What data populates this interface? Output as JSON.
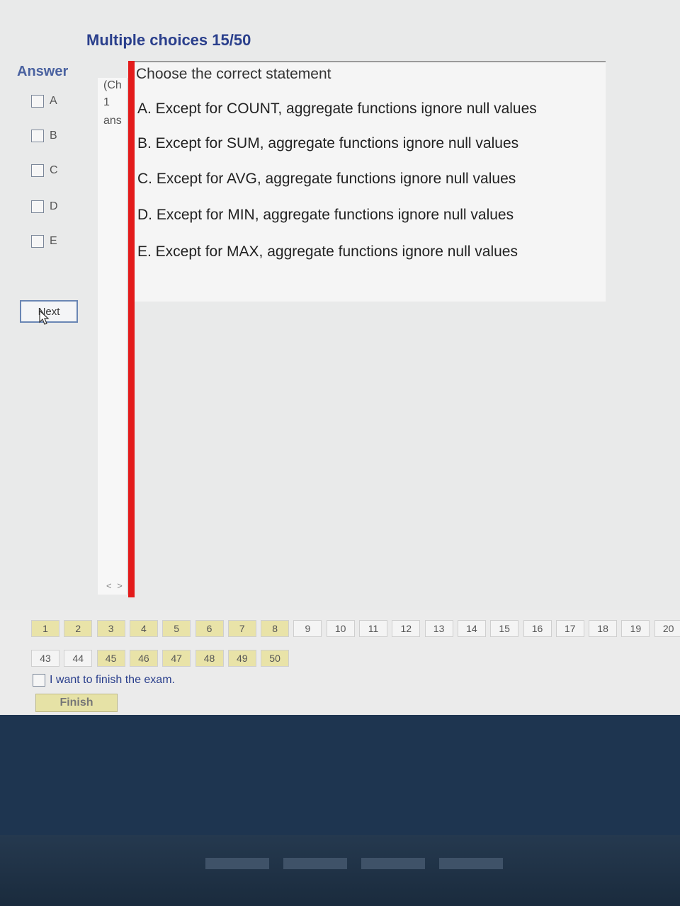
{
  "header": {
    "title": "Multiple choices 15/50"
  },
  "answer_panel": {
    "label": "Answer",
    "options": [
      "A",
      "B",
      "C",
      "D",
      "E"
    ],
    "next_button": "Next"
  },
  "middle_panel": {
    "lines": [
      "(Ch",
      "1",
      "ans"
    ],
    "scroll": "< >"
  },
  "question": {
    "prompt": "Choose the correct statement",
    "choices": [
      "A. Except for COUNT, aggregate functions ignore null values",
      "B. Except for SUM, aggregate functions ignore null values",
      "C. Except for AVG, aggregate functions ignore null values",
      "D. Except for MIN, aggregate functions ignore null values",
      "E. Except for MAX, aggregate functions ignore null values"
    ]
  },
  "pager": {
    "row1": [
      "1",
      "2",
      "3",
      "4",
      "5",
      "6",
      "7",
      "8",
      "9",
      "10",
      "11",
      "12",
      "13",
      "14",
      "15",
      "16",
      "17",
      "18",
      "19",
      "20"
    ],
    "row2": [
      "43",
      "44",
      "45",
      "46",
      "47",
      "48",
      "49",
      "50"
    ],
    "answered_row1": [
      "1",
      "2",
      "3",
      "4",
      "5",
      "6",
      "7",
      "8"
    ],
    "answered_row2": [
      "45",
      "46",
      "47",
      "48",
      "49",
      "50"
    ]
  },
  "finish": {
    "checkbox_label": "I want to finish the exam.",
    "button": "Finish"
  },
  "colors": {
    "accent": "#e31b1b",
    "title": "#2a3f8c",
    "answered": "#e9e3a8"
  }
}
